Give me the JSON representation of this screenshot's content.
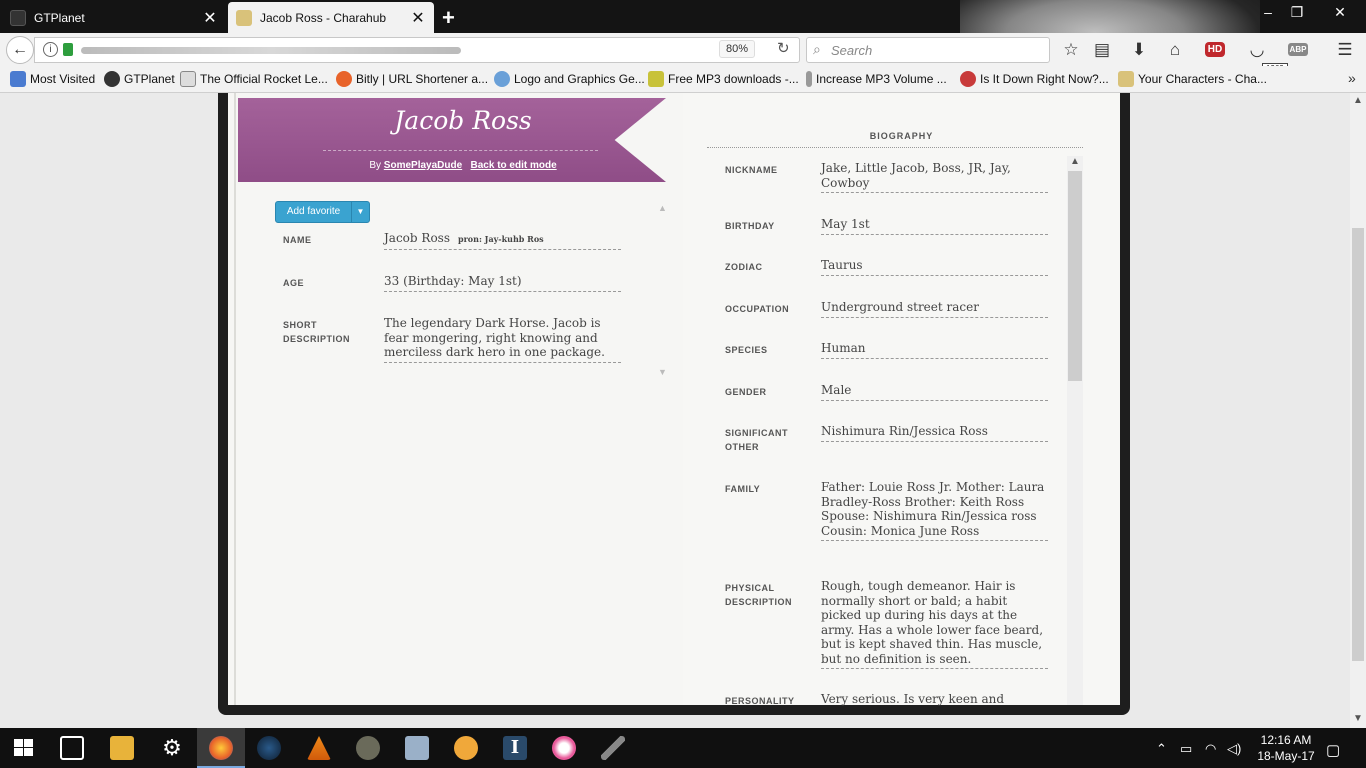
{
  "browser": {
    "tabs": [
      {
        "title": "GTPlanet",
        "active": false
      },
      {
        "title": "Jacob Ross - Charahub",
        "active": true
      }
    ],
    "zoom": "80%",
    "search_placeholder": "Search",
    "bookmarks": [
      "Most Visited",
      "GTPlanet",
      "The Official Rocket Le...",
      "Bitly | URL Shortener a...",
      "Logo and Graphics Ge...",
      "Free MP3 downloads -...",
      "Increase MP3 Volume ...",
      "Is It Down Right Now?...",
      "Your Characters - Cha..."
    ],
    "badge_text": "1969",
    "hd_label": "HD",
    "abp_label": "ABP"
  },
  "character": {
    "name": "Jacob Ross",
    "by_label": "By",
    "author": "SomePlayaDude",
    "edit_link": "Back to edit mode",
    "favorite_button": "Add favorite",
    "profile": [
      {
        "label": "NAME",
        "value": "Jacob Ross",
        "note": "pron: Jay-kuhb Ros"
      },
      {
        "label": "AGE",
        "value": "33 (Birthday: May 1st)"
      },
      {
        "label": "SHORT DESCRIPTION",
        "value": "The legendary Dark Horse. Jacob is fear mongering, right knowing and merciless dark hero in one package."
      }
    ]
  },
  "biography": {
    "title": "BIOGRAPHY",
    "fields": [
      {
        "label": "NICKNAME",
        "value": "Jake, Little Jacob, Boss, JR, Jay, Cowboy"
      },
      {
        "label": "BIRTHDAY",
        "value": "May 1st"
      },
      {
        "label": "ZODIAC",
        "value": "Taurus"
      },
      {
        "label": "OCCUPATION",
        "value": "Underground street racer"
      },
      {
        "label": "SPECIES",
        "value": "Human"
      },
      {
        "label": "GENDER",
        "value": "Male"
      },
      {
        "label": "SIGNIFICANT OTHER",
        "value": "Nishimura Rin/Jessica Ross"
      },
      {
        "label": "FAMILY",
        "value": "Father: Louie Ross Jr. Mother: Laura Bradley-Ross Brother: Keith Ross Spouse: Nishimura Rin/Jessica ross Cousin: Monica June Ross"
      },
      {
        "label": "PHYSICAL DESCRIPTION",
        "value": "Rough, tough demeanor. Hair is normally short or bald; a habit picked up during his days at the army. Has a whole lower face beard, but is kept shaved thin. Has muscle, but no definition is seen."
      },
      {
        "label": "PERSONALITY",
        "value": "Very serious. Is very keen and"
      }
    ]
  },
  "taskbar": {
    "time": "12:16 AM",
    "date": "18-May-17"
  }
}
